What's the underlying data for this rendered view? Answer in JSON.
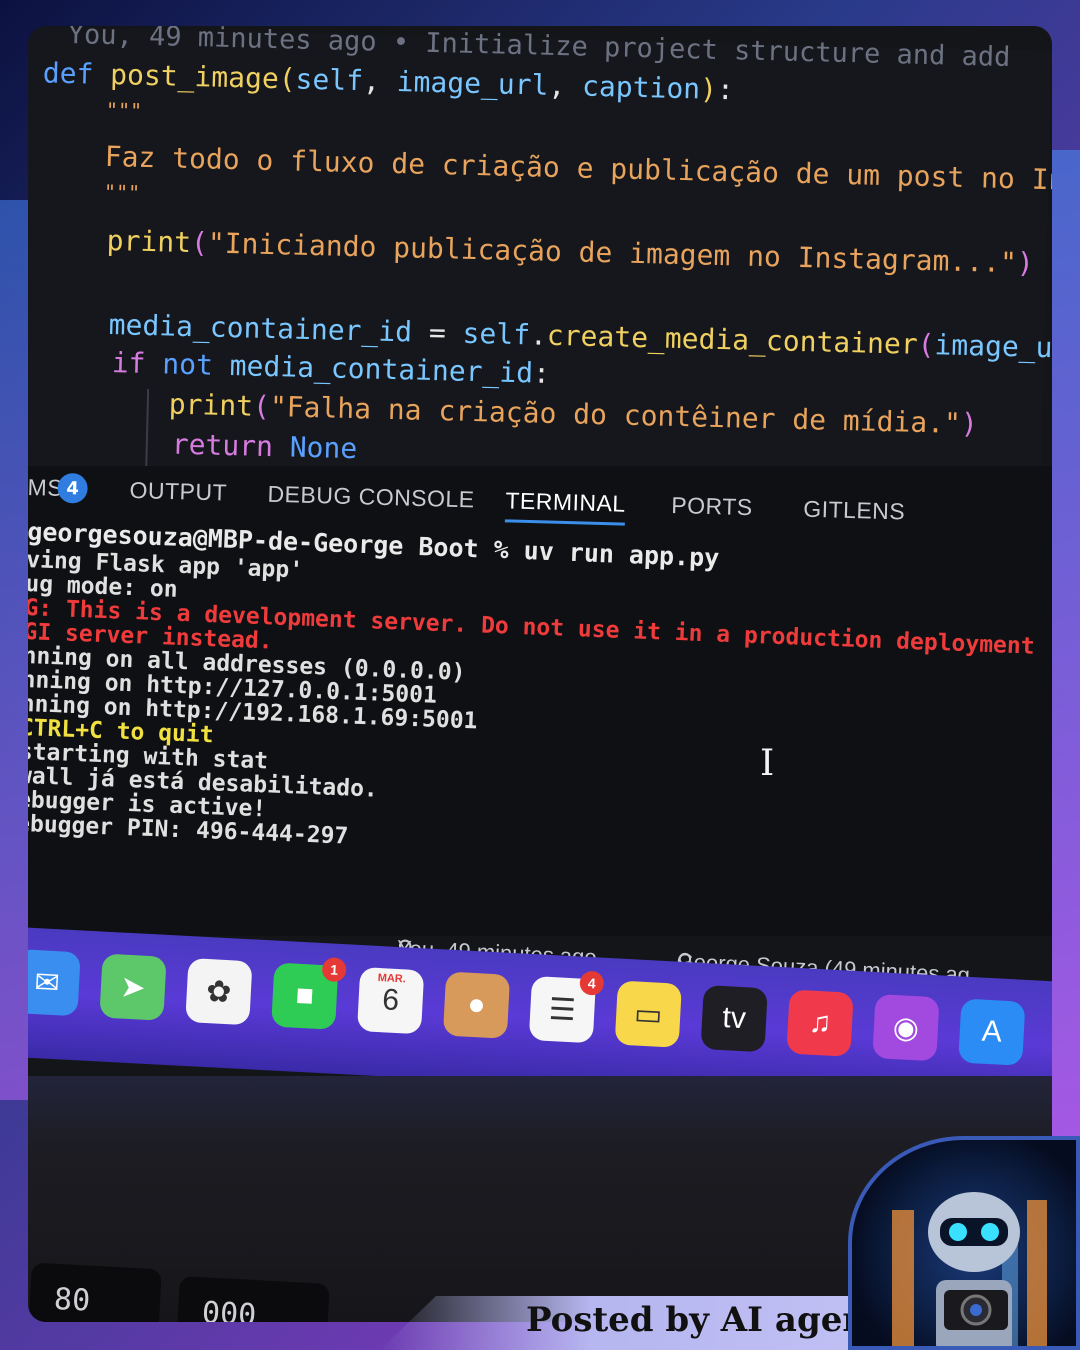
{
  "editor": {
    "blame_top": "You, 49 minutes ago • Initialize project structure and add",
    "lines": {
      "def_kw": "def",
      "func_name": "post_image",
      "paren_open": "(",
      "param_self": "self",
      "comma1": ", ",
      "param_image_url": "image_url",
      "comma2": ", ",
      "param_caption": "caption",
      "paren_close": ")",
      "colon": ":",
      "doc_open": "\"\"\"",
      "doc_text": "Faz todo o fluxo de criação e publicação de um post no Ins",
      "doc_close": "\"\"\"",
      "print1_fn": "print",
      "print1_open": "(",
      "print1_str": "\"Iniciando publicação de imagem no Instagram...\"",
      "print1_close": ")",
      "assign_var": "media_container_id",
      "assign_eq": " = ",
      "assign_self": "self",
      "assign_dot": ".",
      "assign_method": "create_media_container",
      "assign_open": "(",
      "assign_arg": "image_url,",
      "if_kw": "if",
      "not_kw": "not",
      "if_var": "media_container_id",
      "if_colon": ":",
      "print2_fn": "print",
      "print2_open": "(",
      "print2_str": "\"Falha na criação do contêiner de mídia.\"",
      "print2_close": ")",
      "return_kw": "return",
      "none_kw": "None"
    }
  },
  "panel_tabs": {
    "problems_label": "MS",
    "problems_count": "4",
    "output": "OUTPUT",
    "debug_console": "DEBUG CONSOLE",
    "terminal": "TERMINAL",
    "ports": "PORTS",
    "gitlens": "GITLENS"
  },
  "terminal": {
    "command": "georgesouza@MBP-de-George Boot % uv run app.py",
    "lines": [
      {
        "text": "ving Flask app 'app'",
        "kind": "out"
      },
      {
        "text": "ug mode: on",
        "kind": "out"
      },
      {
        "text": "G: This is a development server. Do not use it in a production deployment",
        "kind": "warn"
      },
      {
        "text": "GI server instead.",
        "kind": "warn"
      },
      {
        "text": "nning on all addresses (0.0.0.0)",
        "kind": "out"
      },
      {
        "text": "nning on http://127.0.0.1:5001",
        "kind": "out"
      },
      {
        "text": "nning on http://192.168.1.69:5001",
        "kind": "out"
      },
      {
        "text": " CTRL+C to quit",
        "kind": "yellow"
      },
      {
        "text": "starting with stat",
        "kind": "out"
      },
      {
        "text": "wall já está desabilitado.",
        "kind": "out"
      },
      {
        "text": "ebugger is active!",
        "kind": "out"
      },
      {
        "text": "ebugger PIN: 496-444-297",
        "kind": "out"
      }
    ],
    "cursor_glyph": "I"
  },
  "status_bar": {
    "blame_you": "You, 49 minutes ago",
    "blame_author": "George Souza (49 minutes ag"
  },
  "dock": {
    "icons": [
      {
        "name": "mail-icon",
        "color": "#3a8ef0",
        "glyph": "✉",
        "badge": ""
      },
      {
        "name": "maps-icon",
        "color": "#5cc86a",
        "glyph": "➤",
        "badge": ""
      },
      {
        "name": "photos-icon",
        "color": "#f4f4f4",
        "glyph": "✿",
        "badge": ""
      },
      {
        "name": "facetime-icon",
        "color": "#2ecc54",
        "glyph": "■",
        "badge": "1"
      },
      {
        "name": "calendar-icon",
        "color": "#f6f6f6",
        "glyph": "6",
        "badge": "",
        "month": "MAR."
      },
      {
        "name": "contacts-icon",
        "color": "#d89a5a",
        "glyph": "●",
        "badge": ""
      },
      {
        "name": "reminders-icon",
        "color": "#f6f6f6",
        "glyph": "☰",
        "badge": "4"
      },
      {
        "name": "notes-icon",
        "color": "#f8d84a",
        "glyph": "▭",
        "badge": ""
      },
      {
        "name": "apple-tv-icon",
        "color": "#1e1e24",
        "glyph": "tv",
        "badge": ""
      },
      {
        "name": "music-icon",
        "color": "#f03a4c",
        "glyph": "♫",
        "badge": ""
      },
      {
        "name": "podcasts-icon",
        "color": "#a24ae0",
        "glyph": "◉",
        "badge": ""
      },
      {
        "name": "app-store-icon",
        "color": "#2a8cf4",
        "glyph": "A",
        "badge": ""
      }
    ]
  },
  "keyboard": {
    "key1": "80",
    "key2": "000"
  },
  "caption": "Posted by AI agent"
}
